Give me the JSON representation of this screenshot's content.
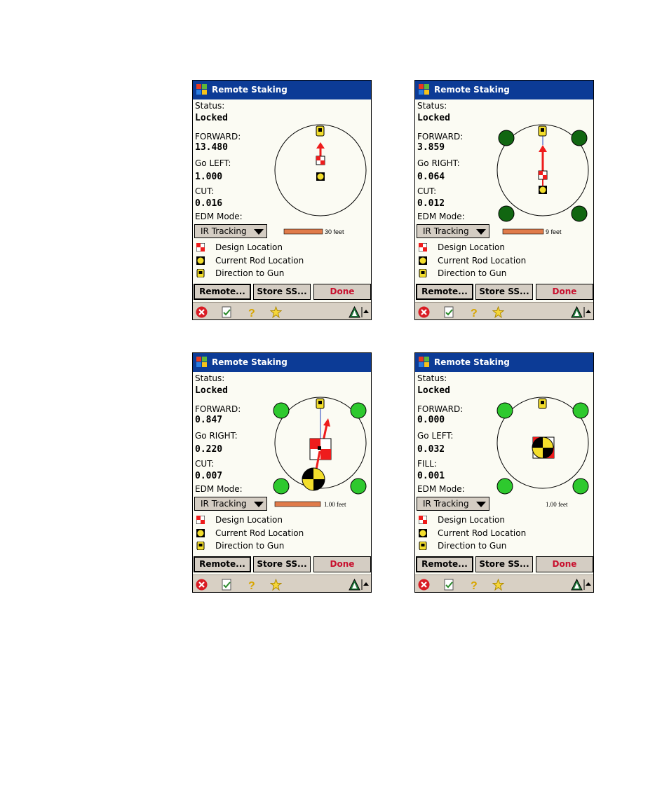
{
  "screens": [
    {
      "title": "Remote Staking",
      "status_label": "Status:",
      "status_value": "Locked",
      "fwd_label": "FORWARD:",
      "fwd_value": "13.480",
      "side_label": "Go LEFT:",
      "side_value": "1.000",
      "cutfill_label": "CUT:",
      "cutfill_value": "0.016",
      "edm_label": "EDM Mode:",
      "edm_value": "IR Tracking",
      "scale_label": "30 feet",
      "legend": [
        "Design Location",
        "Current Rod Location",
        "Direction to Gun"
      ],
      "buttons": {
        "remote": "Remote...",
        "store": "Store SS...",
        "done": "Done"
      }
    },
    {
      "title": "Remote Staking",
      "status_label": "Status:",
      "status_value": "Locked",
      "fwd_label": "FORWARD:",
      "fwd_value": "3.859",
      "side_label": "Go RIGHT:",
      "side_value": "0.064",
      "cutfill_label": "CUT:",
      "cutfill_value": "0.012",
      "edm_label": "EDM Mode:",
      "edm_value": "IR Tracking",
      "scale_label": "9 feet",
      "legend": [
        "Design Location",
        "Current Rod Location",
        "Direction to Gun"
      ],
      "buttons": {
        "remote": "Remote...",
        "store": "Store SS...",
        "done": "Done"
      }
    },
    {
      "title": "Remote Staking",
      "status_label": "Status:",
      "status_value": "Locked",
      "fwd_label": "FORWARD:",
      "fwd_value": "0.847",
      "side_label": "Go RIGHT:",
      "side_value": "0.220",
      "cutfill_label": "CUT:",
      "cutfill_value": "0.007",
      "edm_label": "EDM Mode:",
      "edm_value": "IR Tracking",
      "scale_label": "1.00 feet",
      "legend": [
        "Design Location",
        "Current Rod Location",
        "Direction to Gun"
      ],
      "buttons": {
        "remote": "Remote...",
        "store": "Store SS...",
        "done": "Done"
      }
    },
    {
      "title": "Remote Staking",
      "status_label": "Status:",
      "status_value": "Locked",
      "fwd_label": "FORWARD:",
      "fwd_value": "0.000",
      "side_label": "Go LEFT:",
      "side_value": "0.032",
      "cutfill_label": "FILL:",
      "cutfill_value": "0.001",
      "edm_label": "EDM Mode:",
      "edm_value": "IR Tracking",
      "scale_label": "1.00 feet",
      "legend": [
        "Design Location",
        "Current Rod Location",
        "Direction to Gun"
      ],
      "buttons": {
        "remote": "Remote...",
        "store": "Store SS...",
        "done": "Done"
      }
    }
  ],
  "colors": {
    "titlebar": "#0c3b96",
    "arrow": "#ee1c1c",
    "done": "#c8102e",
    "scale_bar": "#e07b4a",
    "light_green": "#2ec92e",
    "dark_green": "#116611"
  },
  "icons": [
    "windows-start-icon",
    "close-icon",
    "task-icon",
    "help-icon",
    "favorites-icon",
    "trimble-icon",
    "up-arrow-icon"
  ]
}
